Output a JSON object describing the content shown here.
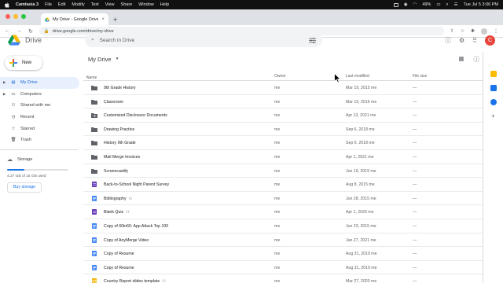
{
  "menubar": {
    "app": "Camtasia 3",
    "items": [
      "File",
      "Edit",
      "Modify",
      "Text",
      "View",
      "Share",
      "Window",
      "Help"
    ],
    "battery": "49%",
    "clock": "Tue Jul 5  3:06 PM"
  },
  "browser": {
    "tab_title": "My Drive - Google Drive",
    "tab_close": "×",
    "new_tab": "+",
    "url": "drive.google.com/drive/my-drive"
  },
  "header": {
    "app_name": "Drive",
    "search_placeholder": "Search in Drive",
    "avatar_letter": "C"
  },
  "sidebar": {
    "new_label": "New",
    "items": [
      {
        "label": "My Drive",
        "icon": "drive-icon",
        "glyph": "▤",
        "expandable": true
      },
      {
        "label": "Computers",
        "icon": "computer-icon",
        "glyph": "▭",
        "expandable": true
      },
      {
        "label": "Shared with me",
        "icon": "people-icon",
        "glyph": "⚇",
        "expandable": false
      },
      {
        "label": "Recent",
        "icon": "clock-icon",
        "glyph": "◷",
        "expandable": false
      },
      {
        "label": "Starred",
        "icon": "star-icon",
        "glyph": "☆",
        "expandable": false
      },
      {
        "label": "Trash",
        "icon": "trash-icon",
        "glyph": "🗑",
        "expandable": false
      }
    ],
    "storage_label": "Storage",
    "storage_text": "4.27 GB of 15 GB used",
    "storage_fraction": 0.285,
    "buy_label": "Buy storage"
  },
  "main": {
    "title": "My Drive",
    "columns": {
      "name": "Name",
      "sort_arrow": "↑",
      "owner": "Owner",
      "modified": "Last modified",
      "size": "File size"
    },
    "files": [
      {
        "name": "9th Grade History",
        "type": "folder",
        "shared": false,
        "owner": "me",
        "modified": "Mar 19, 2015 me",
        "size": "—"
      },
      {
        "name": "Classroom",
        "type": "folder",
        "shared": false,
        "owner": "me",
        "modified": "Mar 19, 2016 me",
        "size": "—"
      },
      {
        "name": "Customized Disclosure Documents",
        "type": "folder-shared",
        "shared": false,
        "owner": "me",
        "modified": "Apr 13, 2021 me",
        "size": "—"
      },
      {
        "name": "Drawing Practice",
        "type": "folder",
        "shared": false,
        "owner": "me",
        "modified": "Sep 6, 2018 me",
        "size": "—"
      },
      {
        "name": "History 9th Grade",
        "type": "folder",
        "shared": false,
        "owner": "me",
        "modified": "Sep 6, 2018 me",
        "size": "—"
      },
      {
        "name": "Mail Merge Invoices",
        "type": "folder",
        "shared": false,
        "owner": "me",
        "modified": "Apr 1, 2021 me",
        "size": "—"
      },
      {
        "name": "Screencastify",
        "type": "folder",
        "shared": false,
        "owner": "me",
        "modified": "Jun 19, 2019 me",
        "size": "—"
      },
      {
        "name": "Back-to-School Night Parent Survey",
        "type": "form",
        "shared": false,
        "owner": "me",
        "modified": "Aug 8, 2015 me",
        "size": "—"
      },
      {
        "name": "Bibliography",
        "type": "doc",
        "shared": true,
        "owner": "me",
        "modified": "Jun 28, 2015 me",
        "size": "—"
      },
      {
        "name": "Blank Quiz",
        "type": "form",
        "shared": true,
        "owner": "me",
        "modified": "Apr 1, 2020 me",
        "size": "—"
      },
      {
        "name": "Copy of 60in60: App Attack Top 100",
        "type": "doc",
        "shared": false,
        "owner": "me",
        "modified": "Jun 23, 2015 me",
        "size": "—"
      },
      {
        "name": "Copy of AnyMerge Video",
        "type": "doc",
        "shared": false,
        "owner": "me",
        "modified": "Jan 27, 2021 me",
        "size": "—"
      },
      {
        "name": "Copy of Resume",
        "type": "doc",
        "shared": false,
        "owner": "me",
        "modified": "Aug 31, 2019 me",
        "size": "—"
      },
      {
        "name": "Copy of Resume",
        "type": "doc",
        "shared": false,
        "owner": "me",
        "modified": "Aug 31, 2019 me",
        "size": "—"
      },
      {
        "name": "Country Report slides template",
        "type": "slides",
        "shared": true,
        "owner": "me",
        "modified": "Mar 27, 2020 me",
        "size": "—"
      }
    ]
  },
  "colors": {
    "accent": "#1a73e8",
    "active_bg": "#e8f0fe",
    "folder": "#5f6368",
    "doc": "#4285f4",
    "form": "#673ab7",
    "slides": "#f4b400"
  }
}
